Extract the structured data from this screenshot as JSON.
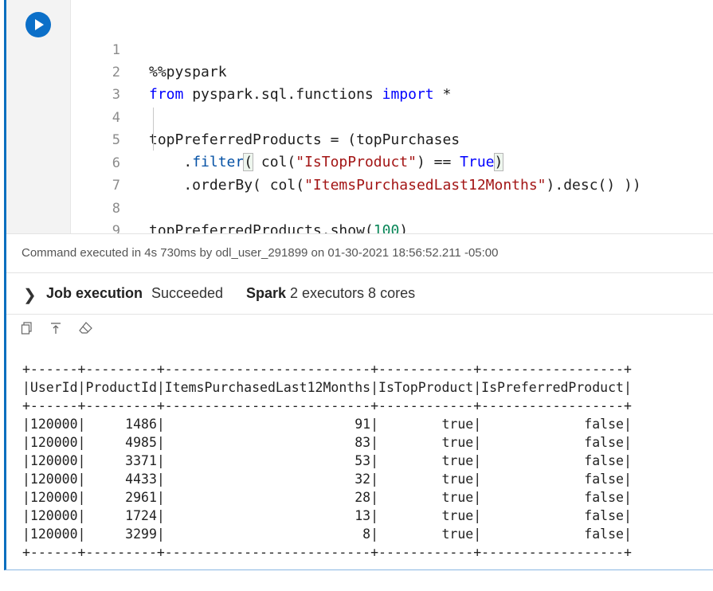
{
  "code": {
    "line_numbers": [
      "1",
      "2",
      "3",
      "4",
      "5",
      "6",
      "7",
      "8",
      "9"
    ],
    "line1": "%%pyspark",
    "line2_from": "from",
    "line2_module": " pyspark.sql.functions ",
    "line2_import": "import",
    "line2_star": " *",
    "line4": "topPreferredProducts = (topPurchases",
    "line5_a": "    .",
    "line5_filter": "filter",
    "line5_paren": "(",
    "line5_b": " col(",
    "line5_str": "\"IsTopProduct\"",
    "line5_c": ") == ",
    "line5_true": "True",
    "line5_close": ")",
    "line6_a": "    .orderBy( col(",
    "line6_str": "\"ItemsPurchasedLast12Months\"",
    "line6_b": ").desc() ))",
    "line8_a": "topPreferredProducts.show(",
    "line8_num": "100",
    "line8_b": ")"
  },
  "status_text": "Command executed in 4s 730ms by odl_user_291899 on 01-30-2021 18:56:52.211 -05:00",
  "job": {
    "label": "Job execution",
    "status": "Succeeded",
    "spark_label": "Spark",
    "spark_detail": "2 executors 8 cores"
  },
  "icons": [
    "copy-icon",
    "export-icon",
    "clear-icon"
  ],
  "output_text": "+------+---------+--------------------------+------------+------------------+\n|UserId|ProductId|ItemsPurchasedLast12Months|IsTopProduct|IsPreferredProduct|\n+------+---------+--------------------------+------------+------------------+\n|120000|     1486|                        91|        true|             false|\n|120000|     4985|                        83|        true|             false|\n|120000|     3371|                        53|        true|             false|\n|120000|     4433|                        32|        true|             false|\n|120000|     2961|                        28|        true|             false|\n|120000|     1724|                        13|        true|             false|\n|120000|     3299|                         8|        true|             false|\n+------+---------+--------------------------+------------+------------------+",
  "colors": {
    "accent": "#0a6fbf",
    "keyword": "#0000ff",
    "string": "#a31515",
    "number": "#098658"
  }
}
